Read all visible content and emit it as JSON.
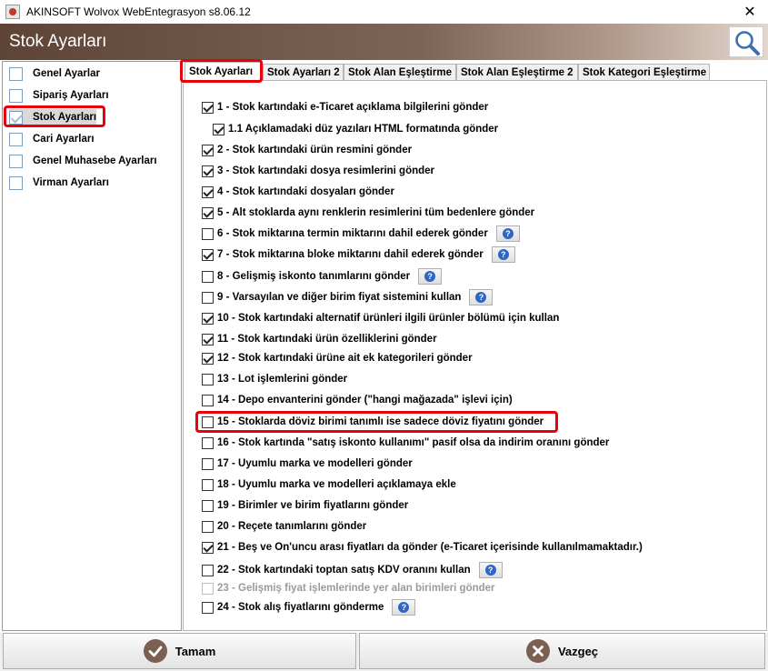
{
  "window": {
    "title": "AKINSOFT Wolvox WebEntegrasyon s8.06.12",
    "close_glyph": "✕"
  },
  "header": {
    "title": "Stok Ayarları",
    "search_icon": "magnifier-icon"
  },
  "sidebar": {
    "items": [
      {
        "label": "Genel Ayarlar",
        "checked": false
      },
      {
        "label": "Sipariş Ayarları",
        "checked": false
      },
      {
        "label": "Stok Ayarları",
        "checked": true,
        "active": true
      },
      {
        "label": "Cari Ayarları",
        "checked": false
      },
      {
        "label": "Genel Muhasebe Ayarları",
        "checked": false
      },
      {
        "label": "Virman Ayarları",
        "checked": false
      }
    ]
  },
  "tabs": [
    {
      "label": "Stok Ayarları",
      "active": true
    },
    {
      "label": "Stok Ayarları 2"
    },
    {
      "label": "Stok Alan Eşleştirme"
    },
    {
      "label": "Stok Alan Eşleştirme 2"
    },
    {
      "label": "Stok Kategori Eşleştirme"
    }
  ],
  "options": [
    {
      "label": "1 - Stok kartındaki e-Ticaret açıklama bilgilerini gönder",
      "checked": true
    },
    {
      "label": "1.1 Açıklamadaki düz yazıları HTML formatında gönder",
      "checked": true
    },
    {
      "label": "2 - Stok kartındaki ürün resmini gönder",
      "checked": true
    },
    {
      "label": "3 - Stok kartındaki dosya resimlerini gönder",
      "checked": true
    },
    {
      "label": "4 - Stok kartındaki dosyaları gönder",
      "checked": true
    },
    {
      "label": "5 - Alt stoklarda aynı renklerin resimlerini tüm bedenlere gönder",
      "checked": true
    },
    {
      "label": "6 - Stok miktarına termin miktarını dahil ederek gönder",
      "checked": false,
      "help": true
    },
    {
      "label": "7 - Stok miktarına bloke miktarını dahil ederek gönder",
      "checked": true,
      "help": true
    },
    {
      "label": "8 - Gelişmiş iskonto tanımlarını gönder",
      "checked": false,
      "help": true
    },
    {
      "label": "9 - Varsayılan ve diğer birim fiyat sistemini kullan",
      "checked": false,
      "help": true
    },
    {
      "label": "10 - Stok kartındaki alternatif ürünleri ilgili ürünler bölümü için kullan",
      "checked": true
    },
    {
      "label": "11 - Stok kartındaki ürün özelliklerini gönder",
      "checked": true
    },
    {
      "label": "12 - Stok kartındaki ürüne ait ek kategorileri gönder",
      "checked": true
    },
    {
      "label": "13 - Lot işlemlerini gönder",
      "checked": false
    },
    {
      "label": "14 - Depo envanterini gönder (\"hangi mağazada\" işlevi için)",
      "checked": false
    },
    {
      "label": "15 - Stoklarda döviz birimi tanımlı ise sadece döviz fiyatını gönder",
      "checked": false
    },
    {
      "label": "16 - Stok kartında \"satış iskonto kullanımı\" pasif olsa da indirim oranını gönder",
      "checked": false
    },
    {
      "label": "17 - Uyumlu marka ve modelleri gönder",
      "checked": false
    },
    {
      "label": "18 - Uyumlu marka ve modelleri açıklamaya ekle",
      "checked": false
    },
    {
      "label": "19 - Birimler ve birim fiyatlarını gönder",
      "checked": false
    },
    {
      "label": "20 - Reçete tanımlarını gönder",
      "checked": false
    },
    {
      "label": "21 - Beş ve On'uncu arası fiyatları da gönder (e-Ticaret içerisinde kullanılmamaktadır.)",
      "checked": true
    },
    {
      "label": "22 - Stok kartındaki toptan satış KDV oranını kullan",
      "checked": false,
      "help": true
    },
    {
      "label": "23 - Gelişmiş fiyat işlemlerinde yer alan birimleri gönder",
      "checked": false,
      "disabled": true
    },
    {
      "label": "24 - Stok alış fiyatlarını gönderme",
      "checked": false,
      "help": true
    }
  ],
  "buttons": {
    "ok_label": "Tamam",
    "cancel_label": "Vazgeç"
  },
  "colors": {
    "highlight": "#e8000a",
    "header_dark": "#5d4436",
    "button_icon": "#7b5f50",
    "help_icon": "#2f66c6"
  }
}
